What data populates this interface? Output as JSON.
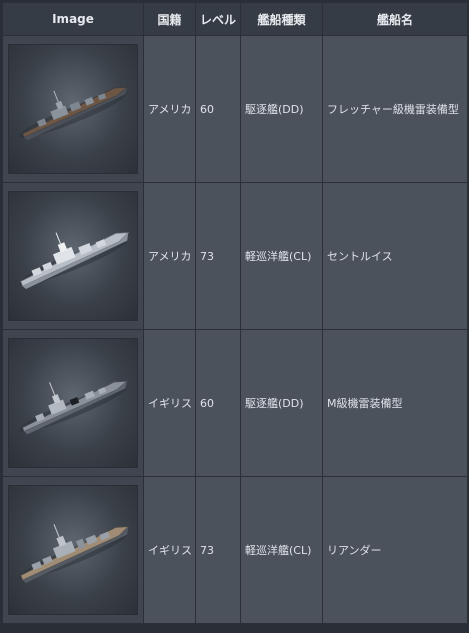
{
  "headers": [
    "Image",
    "国籍",
    "レベル",
    "艦船種類",
    "艦船名"
  ],
  "rows": [
    {
      "nation": "アメリカ",
      "level": "60",
      "type": "駆逐艦(DD)",
      "name": "フレッチャー級機雷装備型",
      "ship_image": "destroyer-ship-image"
    },
    {
      "nation": "アメリカ",
      "level": "73",
      "type": "軽巡洋艦(CL)",
      "name": "セントルイス",
      "ship_image": "light-cruiser-ship-image"
    },
    {
      "nation": "イギリス",
      "level": "60",
      "type": "駆逐艦(DD)",
      "name": "M級機雷装備型",
      "ship_image": "destroyer-ship-image"
    },
    {
      "nation": "イギリス",
      "level": "73",
      "type": "軽巡洋艦(CL)",
      "name": "リアンダー",
      "ship_image": "light-cruiser-ship-image"
    }
  ]
}
